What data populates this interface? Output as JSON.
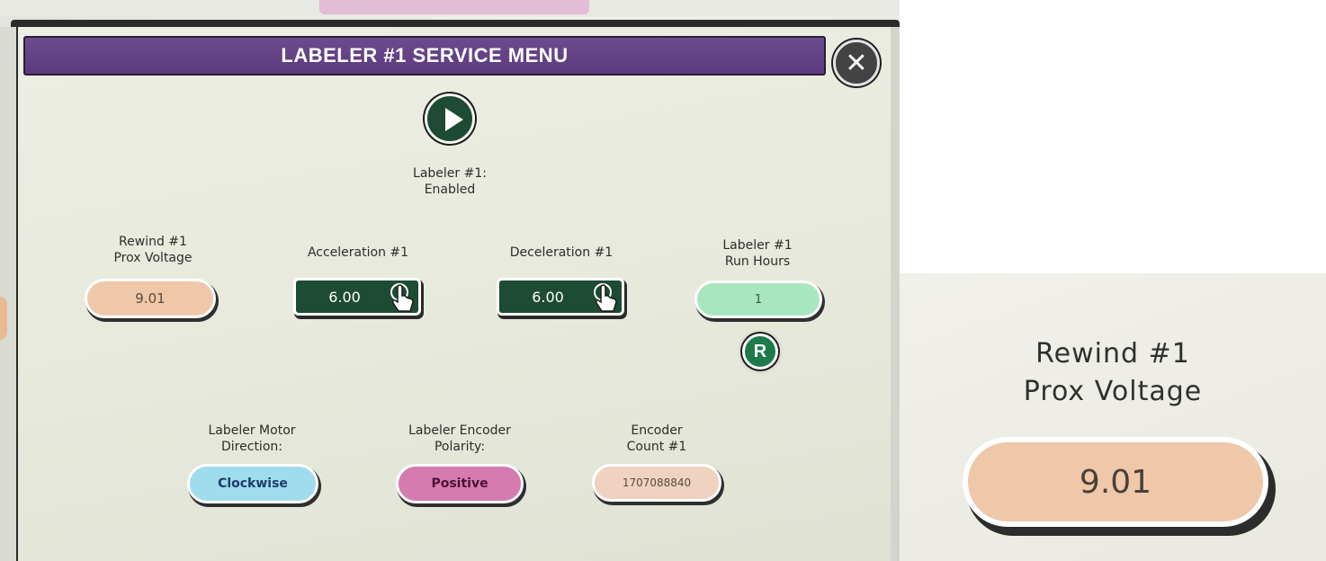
{
  "window": {
    "title": "LABELER #1 SERVICE MENU"
  },
  "labeler_status": {
    "line1": "Labeler #1:",
    "line2": "Enabled"
  },
  "rewind": {
    "label_line1": "Rewind #1",
    "label_line2": "Prox Voltage",
    "value": "9.01"
  },
  "acceleration": {
    "label": "Acceleration #1",
    "value": "6.00"
  },
  "deceleration": {
    "label": "Deceleration #1",
    "value": "6.00"
  },
  "run_hours": {
    "label_line1": "Labeler #1",
    "label_line2": "Run Hours",
    "value": "1",
    "reset_label": "R"
  },
  "motor_direction": {
    "label_line1": "Labeler Motor",
    "label_line2": "Direction:",
    "value": "Clockwise"
  },
  "encoder_polarity": {
    "label_line1": "Labeler Encoder",
    "label_line2": "Polarity:",
    "value": "Positive"
  },
  "encoder_count": {
    "label_line1": "Encoder",
    "label_line2": "Count #1",
    "value": "1707088840"
  },
  "close_glyph": "✕",
  "inset": {
    "label_line1": "Rewind #1",
    "label_line2": "Prox Voltage",
    "value": "9.01"
  },
  "colors": {
    "title_bar": "#5b3a7d",
    "rewind_field": "#efc7a9",
    "setpoint_field": "#1d4b34",
    "run_hours_field": "#a8e6bf",
    "direction_field": "#9fdced",
    "polarity_field": "#d67bb0",
    "encoder_count_field": "#efd2c0"
  }
}
